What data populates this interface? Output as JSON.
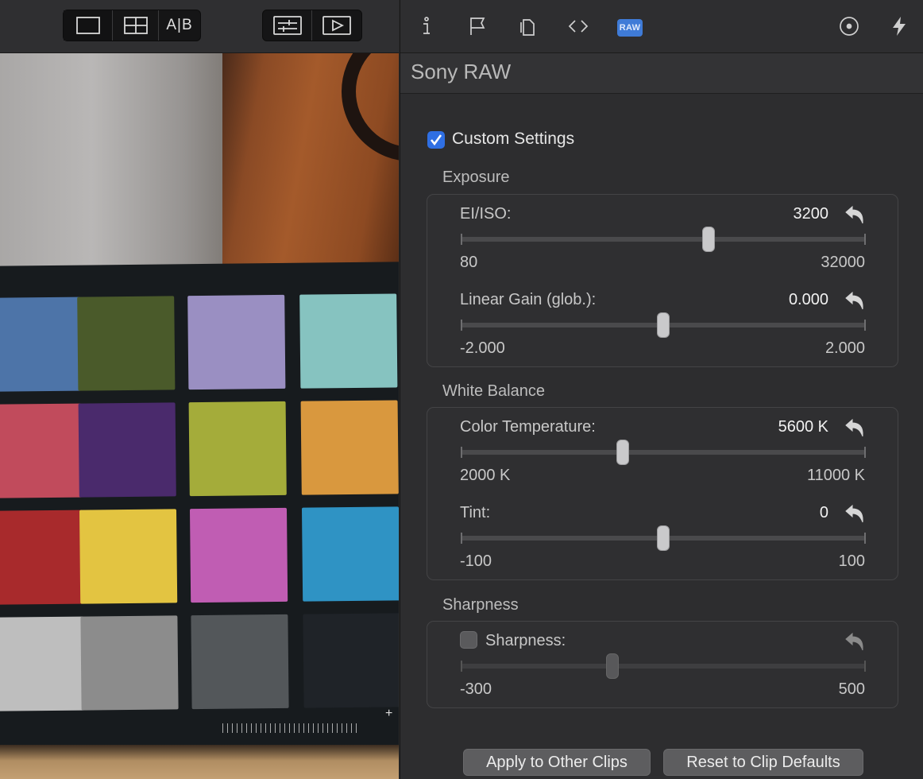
{
  "viewer": {
    "toolbar": {
      "layout_buttons": [
        {
          "name": "single-view",
          "icon": "single-view-icon"
        },
        {
          "name": "grid-view",
          "icon": "grid-view-icon"
        },
        {
          "name": "ab-view",
          "label": "A|B"
        }
      ],
      "mode_buttons": [
        {
          "name": "adjustments",
          "icon": "sliders-icon"
        },
        {
          "name": "playback",
          "icon": "play-icon"
        }
      ]
    },
    "colorchecker_colors": [
      "#4d74a8",
      "#4a5a2a",
      "#9a8fc2",
      "#86c3c0",
      "#c14b5c",
      "#4a2a6c",
      "#a4ac3a",
      "#d9983e",
      "#a82a2c",
      "#e3c441",
      "#c05db3",
      "#2f93c4",
      "#bebebe",
      "#8c8c8c",
      "#53575a",
      "#1f2328"
    ]
  },
  "inspector": {
    "tabs": [
      {
        "name": "info",
        "icon": "info-icon"
      },
      {
        "name": "flag",
        "icon": "flag-icon"
      },
      {
        "name": "copy",
        "icon": "copy-icon"
      },
      {
        "name": "code",
        "icon": "code-icon"
      },
      {
        "name": "raw",
        "label": "RAW",
        "active": true
      },
      {
        "name": "target",
        "icon": "target-icon"
      },
      {
        "name": "bolt",
        "icon": "bolt-icon"
      }
    ],
    "title": "Sony RAW",
    "custom_settings": {
      "label": "Custom Settings",
      "checked": true
    },
    "sections": {
      "exposure": {
        "label": "Exposure",
        "ei_iso": {
          "label": "EI/ISO:",
          "value": "3200",
          "min": "80",
          "max": "32000",
          "position": 0.611
        },
        "linear_gain": {
          "label": "Linear Gain (glob.):",
          "value": "0.000",
          "min": "-2.000",
          "max": "2.000",
          "position": 0.5
        }
      },
      "white_balance": {
        "label": "White Balance",
        "color_temperature": {
          "label": "Color Temperature:",
          "value": "5600 K",
          "min": "2000 K",
          "max": "11000 K",
          "position": 0.4
        },
        "tint": {
          "label": "Tint:",
          "value": "0",
          "min": "-100",
          "max": "100",
          "position": 0.5
        }
      },
      "sharpness": {
        "label": "Sharpness",
        "sharpness": {
          "label": "Sharpness:",
          "enabled": false,
          "min": "-300",
          "max": "500",
          "position": 0.375
        }
      }
    },
    "buttons": {
      "apply": "Apply to Other Clips",
      "reset": "Reset to Clip Defaults"
    },
    "accent_color": "#2f6fe3"
  }
}
